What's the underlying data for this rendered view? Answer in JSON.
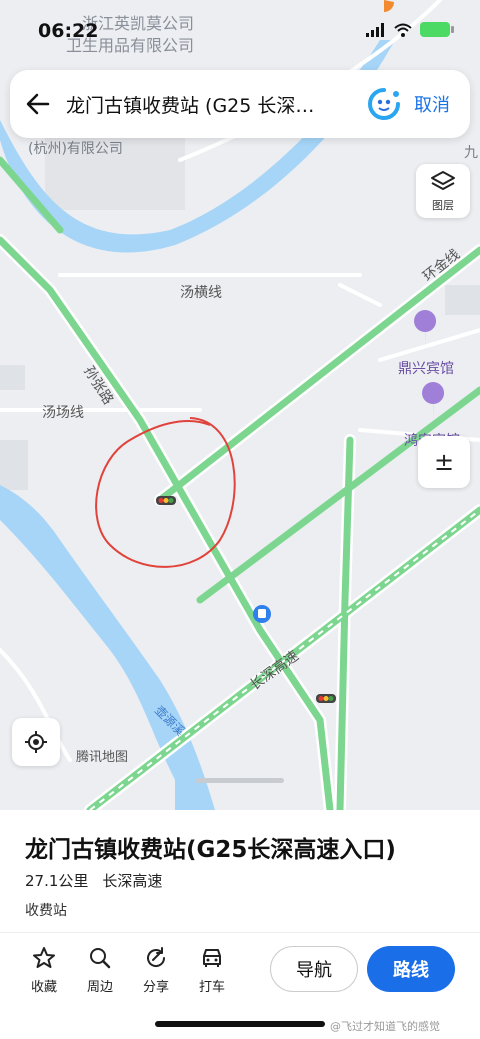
{
  "status": {
    "time": "06:22"
  },
  "search": {
    "query": "龙门古镇收费站 (G25 长深…",
    "cancel": "取消"
  },
  "map": {
    "layer_label": "图层",
    "zoom_label": "±",
    "logo": "腾讯地图",
    "road_labels": [
      "汤横线",
      "环金线",
      "孙张路",
      "汤场线",
      "长深高速"
    ],
    "river_label": "壶源溪",
    "poi_labels": [
      "鼎兴宾馆",
      "鸿安宾馆"
    ],
    "faded_labels": [
      "浙江英凯莫公司",
      "卫生用品有限公司",
      "(杭州)有限公司",
      "九"
    ]
  },
  "place": {
    "name": "龙门古镇收费站(G25长深高速入口)",
    "distance": "27.1公里",
    "road": "长深高速",
    "category": "收费站"
  },
  "actions": [
    {
      "label": "收藏",
      "icon": "star-icon"
    },
    {
      "label": "周边",
      "icon": "search-icon"
    },
    {
      "label": "分享",
      "icon": "share-icon"
    },
    {
      "label": "打车",
      "icon": "taxi-icon"
    }
  ],
  "buttons": {
    "navigate": "导航",
    "route": "路线"
  },
  "watermark": "@飞过才知道飞的感觉",
  "colors": {
    "accent": "#1a6fe8",
    "road_green": "#7dd68f",
    "river": "#a6d5f7"
  }
}
